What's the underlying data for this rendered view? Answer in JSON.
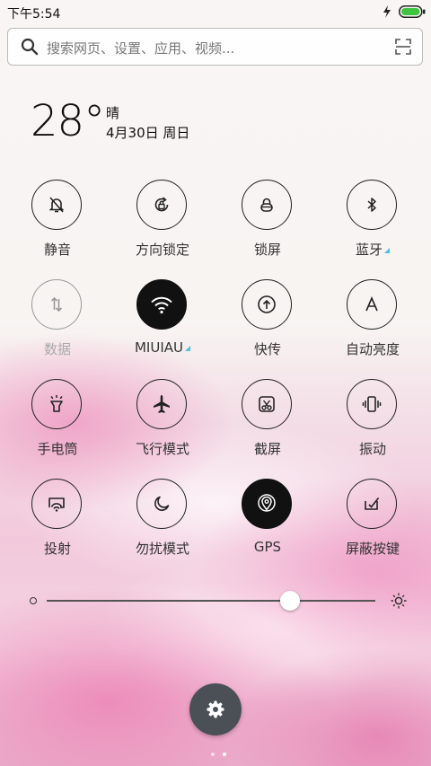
{
  "status_bar": {
    "time": "下午5:54",
    "charging": true
  },
  "search": {
    "placeholder": "搜索网页、设置、应用、视频..."
  },
  "weather": {
    "temperature": "28°",
    "condition": "晴",
    "date": "4月30日 周日"
  },
  "toggles": [
    {
      "label": "静音",
      "icon": "bell-mute-icon",
      "state": "off"
    },
    {
      "label": "方向锁定",
      "icon": "rotation-lock-icon",
      "state": "off"
    },
    {
      "label": "锁屏",
      "icon": "lock-icon",
      "state": "off"
    },
    {
      "label": "蓝牙",
      "icon": "bluetooth-icon",
      "state": "off",
      "has_more": true
    },
    {
      "label": "数据",
      "icon": "mobile-data-icon",
      "state": "disabled"
    },
    {
      "label": "MIUIAU",
      "icon": "wifi-icon",
      "state": "on",
      "has_more": true
    },
    {
      "label": "快传",
      "icon": "quick-transfer-icon",
      "state": "off"
    },
    {
      "label": "自动亮度",
      "icon": "auto-brightness-icon",
      "state": "off"
    },
    {
      "label": "手电筒",
      "icon": "flashlight-icon",
      "state": "off"
    },
    {
      "label": "飞行模式",
      "icon": "airplane-icon",
      "state": "off"
    },
    {
      "label": "截屏",
      "icon": "screenshot-icon",
      "state": "off"
    },
    {
      "label": "振动",
      "icon": "vibrate-icon",
      "state": "off"
    },
    {
      "label": "投射",
      "icon": "cast-icon",
      "state": "off"
    },
    {
      "label": "勿扰模式",
      "icon": "moon-icon",
      "state": "off"
    },
    {
      "label": "GPS",
      "icon": "gps-icon",
      "state": "on"
    },
    {
      "label": "屏蔽按键",
      "icon": "block-keys-icon",
      "state": "off"
    }
  ],
  "brightness": {
    "level": 0.74
  },
  "pager": {
    "pages": 2,
    "current": 2
  },
  "colors": {
    "accent_triangle": "#4ac1e8",
    "active_tile": "#111111",
    "settings_fab": "#4a5056"
  }
}
